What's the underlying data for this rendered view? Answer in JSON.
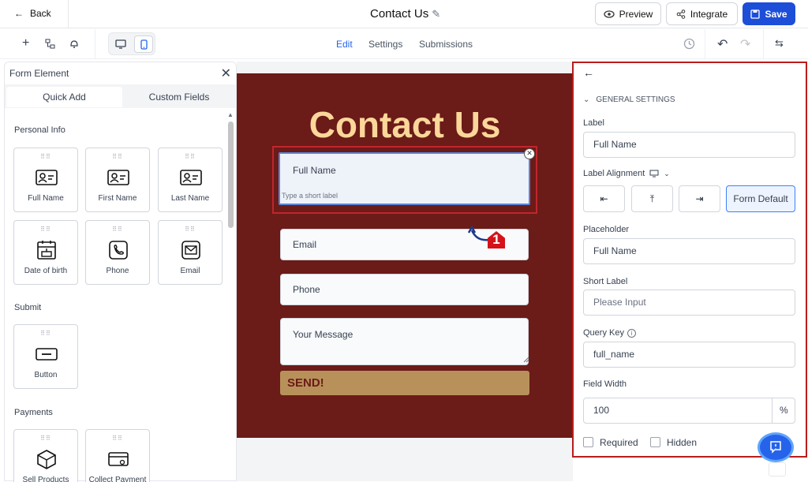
{
  "topbar": {
    "back_label": "Back",
    "title": "Contact Us",
    "preview_label": "Preview",
    "integrate_label": "Integrate",
    "save_label": "Save"
  },
  "tabs": [
    "Edit",
    "Settings",
    "Submissions"
  ],
  "left_panel": {
    "title": "Form Element",
    "tab_quick_add": "Quick Add",
    "tab_custom_fields": "Custom Fields",
    "sections": [
      {
        "title": "Personal Info",
        "items": [
          "Full Name",
          "First Name",
          "Last Name",
          "Date of birth",
          "Phone",
          "Email"
        ]
      },
      {
        "title": "Submit",
        "items": [
          "Button"
        ]
      },
      {
        "title": "Payments",
        "items": [
          "Sell Products",
          "Collect Payment"
        ]
      }
    ]
  },
  "form": {
    "title": "Contact Us",
    "full_name_label": "Full Name",
    "full_name_short": "Type a short label",
    "email": "Email",
    "phone": "Phone",
    "message": "Your Message",
    "send": "SEND!",
    "badge": "1"
  },
  "right_panel": {
    "section_title": "GENERAL SETTINGS",
    "label_title": "Label",
    "label_value": "Full Name",
    "alignment_title": "Label Alignment",
    "alignment_selected": "Form Default",
    "placeholder_title": "Placeholder",
    "placeholder_value": "Full Name",
    "short_label_title": "Short Label",
    "short_label_placeholder": "Please Input",
    "query_key_title": "Query Key",
    "query_key_value": "full_name",
    "width_title": "Field Width",
    "width_value": "100",
    "width_unit": "%",
    "required_label": "Required",
    "hidden_label": "Hidden"
  },
  "colors": {
    "accent": "#1d4ed8",
    "form_bg": "#6b1b18",
    "title_color": "#fcd79a",
    "send_bg": "#b8915a",
    "highlight": "#c0262d"
  }
}
